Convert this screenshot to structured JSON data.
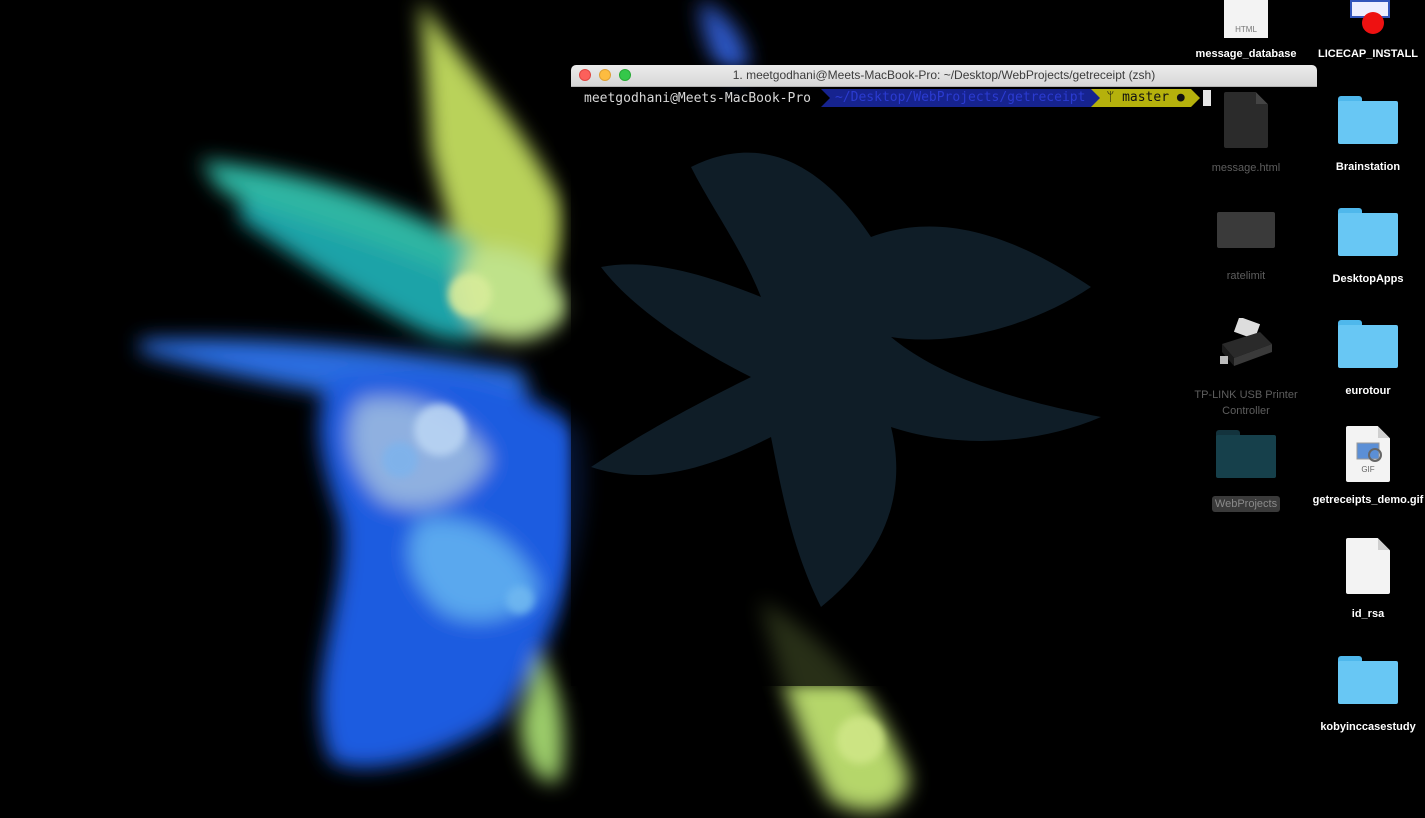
{
  "terminal": {
    "title": "1. meetgodhani@Meets-MacBook-Pro: ~/Desktop/WebProjects/getreceipt (zsh)",
    "prompt_user": "meetgodhani@Meets-MacBook-Pro",
    "prompt_dir": "~/Desktop/WebProjects/getreceipt",
    "prompt_branch": "master",
    "git_icon": "git-branch-glyph",
    "dirty_marker": "●"
  },
  "desktop": {
    "icons": [
      {
        "label": "message_database",
        "type": "html-file"
      },
      {
        "label": "LICECAP_INSTALL",
        "type": "installer"
      },
      {
        "label": "message.html",
        "type": "document"
      },
      {
        "label": "Brainstation",
        "type": "folder"
      },
      {
        "label": "ratelimit",
        "type": "file"
      },
      {
        "label": "DesktopApps",
        "type": "folder"
      },
      {
        "label": "TP-LINK USB Printer Controller",
        "type": "printer"
      },
      {
        "label": "eurotour",
        "type": "folder"
      },
      {
        "label": "WebProjects",
        "type": "folder"
      },
      {
        "label": "getreceipts_demo.gif",
        "type": "gif"
      },
      {
        "label": "id_rsa",
        "type": "document"
      },
      {
        "label": "kobyinccasestudy",
        "type": "folder"
      }
    ],
    "html_badge": "HTML",
    "gif_badge": "GIF"
  },
  "colors": {
    "dir_bg": "#16238f",
    "branch_bg": "#b5b10c",
    "folder": "#68c7f4"
  }
}
